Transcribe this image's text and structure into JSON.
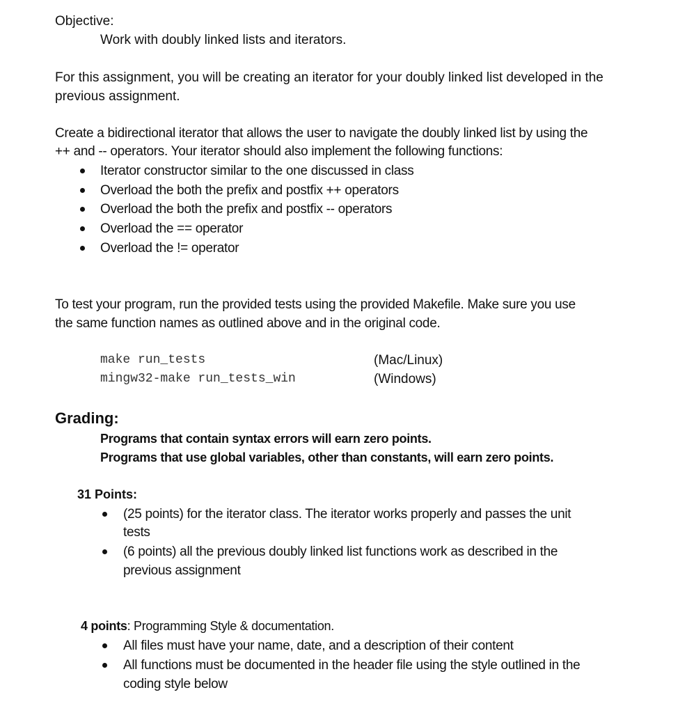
{
  "objective": {
    "heading": "Objective:",
    "text": "Work with doubly linked lists and iterators."
  },
  "intro": {
    "line1": "For this assignment, you will be creating an iterator for your doubly linked list developed in the",
    "line2": "previous assignment."
  },
  "requirements": {
    "line1": "Create a bidirectional iterator that allows the user to navigate the doubly linked list by using the",
    "line2": "++ and -- operators. Your iterator should also implement the following functions:",
    "items": [
      "Iterator constructor similar to the one discussed in class",
      "Overload the both the prefix and postfix ++ operators",
      "Overload the both the prefix and postfix -- operators",
      "Overload the == operator",
      "Overload the != operator"
    ]
  },
  "testing": {
    "line1": "To test your program, run the provided tests using the provided Makefile. Make sure you use",
    "line2": "the same function names as outlined above and in the original code.",
    "commands": [
      {
        "command": "make run_tests",
        "platform": "(Mac/Linux)"
      },
      {
        "command": "mingw32-make run_tests_win",
        "platform": "(Windows)"
      }
    ]
  },
  "grading": {
    "heading": "Grading:",
    "rules": [
      "Programs that contain syntax errors will earn zero points.",
      "Programs that use global variables, other than constants, will earn zero points."
    ],
    "section1": {
      "heading": "31 Points:",
      "items": [
        {
          "line1": "(25 points) for the iterator class.  The iterator works properly and passes the unit",
          "line2": "tests"
        },
        {
          "line1": "(6 points) all the previous doubly linked list functions work as described in the",
          "line2": "previous assignment"
        }
      ]
    },
    "section2": {
      "heading_bold": "4 points",
      "heading_rest": ": Programming Style & documentation.",
      "items": [
        {
          "line1": "All files must have your name, date, and a description of their content",
          "line2": ""
        },
        {
          "line1": "All functions must be documented in the header file using the style outlined in the",
          "line2": "coding style below"
        }
      ]
    }
  }
}
